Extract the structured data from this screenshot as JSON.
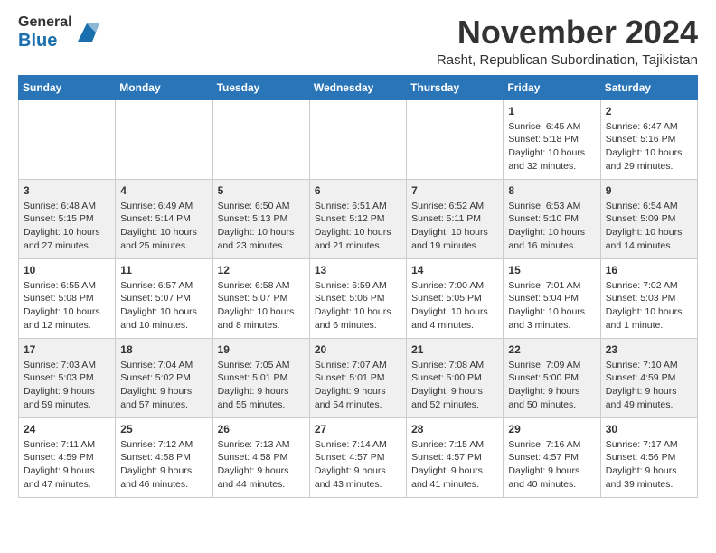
{
  "header": {
    "logo_general": "General",
    "logo_blue": "Blue",
    "month_title": "November 2024",
    "subtitle": "Rasht, Republican Subordination, Tajikistan"
  },
  "weekdays": [
    "Sunday",
    "Monday",
    "Tuesday",
    "Wednesday",
    "Thursday",
    "Friday",
    "Saturday"
  ],
  "weeks": [
    {
      "row_shade": "odd",
      "days": [
        {
          "num": "",
          "info": ""
        },
        {
          "num": "",
          "info": ""
        },
        {
          "num": "",
          "info": ""
        },
        {
          "num": "",
          "info": ""
        },
        {
          "num": "",
          "info": ""
        },
        {
          "num": "1",
          "info": "Sunrise: 6:45 AM\nSunset: 5:18 PM\nDaylight: 10 hours\nand 32 minutes."
        },
        {
          "num": "2",
          "info": "Sunrise: 6:47 AM\nSunset: 5:16 PM\nDaylight: 10 hours\nand 29 minutes."
        }
      ]
    },
    {
      "row_shade": "even",
      "days": [
        {
          "num": "3",
          "info": "Sunrise: 6:48 AM\nSunset: 5:15 PM\nDaylight: 10 hours\nand 27 minutes."
        },
        {
          "num": "4",
          "info": "Sunrise: 6:49 AM\nSunset: 5:14 PM\nDaylight: 10 hours\nand 25 minutes."
        },
        {
          "num": "5",
          "info": "Sunrise: 6:50 AM\nSunset: 5:13 PM\nDaylight: 10 hours\nand 23 minutes."
        },
        {
          "num": "6",
          "info": "Sunrise: 6:51 AM\nSunset: 5:12 PM\nDaylight: 10 hours\nand 21 minutes."
        },
        {
          "num": "7",
          "info": "Sunrise: 6:52 AM\nSunset: 5:11 PM\nDaylight: 10 hours\nand 19 minutes."
        },
        {
          "num": "8",
          "info": "Sunrise: 6:53 AM\nSunset: 5:10 PM\nDaylight: 10 hours\nand 16 minutes."
        },
        {
          "num": "9",
          "info": "Sunrise: 6:54 AM\nSunset: 5:09 PM\nDaylight: 10 hours\nand 14 minutes."
        }
      ]
    },
    {
      "row_shade": "odd",
      "days": [
        {
          "num": "10",
          "info": "Sunrise: 6:55 AM\nSunset: 5:08 PM\nDaylight: 10 hours\nand 12 minutes."
        },
        {
          "num": "11",
          "info": "Sunrise: 6:57 AM\nSunset: 5:07 PM\nDaylight: 10 hours\nand 10 minutes."
        },
        {
          "num": "12",
          "info": "Sunrise: 6:58 AM\nSunset: 5:07 PM\nDaylight: 10 hours\nand 8 minutes."
        },
        {
          "num": "13",
          "info": "Sunrise: 6:59 AM\nSunset: 5:06 PM\nDaylight: 10 hours\nand 6 minutes."
        },
        {
          "num": "14",
          "info": "Sunrise: 7:00 AM\nSunset: 5:05 PM\nDaylight: 10 hours\nand 4 minutes."
        },
        {
          "num": "15",
          "info": "Sunrise: 7:01 AM\nSunset: 5:04 PM\nDaylight: 10 hours\nand 3 minutes."
        },
        {
          "num": "16",
          "info": "Sunrise: 7:02 AM\nSunset: 5:03 PM\nDaylight: 10 hours\nand 1 minute."
        }
      ]
    },
    {
      "row_shade": "even",
      "days": [
        {
          "num": "17",
          "info": "Sunrise: 7:03 AM\nSunset: 5:03 PM\nDaylight: 9 hours\nand 59 minutes."
        },
        {
          "num": "18",
          "info": "Sunrise: 7:04 AM\nSunset: 5:02 PM\nDaylight: 9 hours\nand 57 minutes."
        },
        {
          "num": "19",
          "info": "Sunrise: 7:05 AM\nSunset: 5:01 PM\nDaylight: 9 hours\nand 55 minutes."
        },
        {
          "num": "20",
          "info": "Sunrise: 7:07 AM\nSunset: 5:01 PM\nDaylight: 9 hours\nand 54 minutes."
        },
        {
          "num": "21",
          "info": "Sunrise: 7:08 AM\nSunset: 5:00 PM\nDaylight: 9 hours\nand 52 minutes."
        },
        {
          "num": "22",
          "info": "Sunrise: 7:09 AM\nSunset: 5:00 PM\nDaylight: 9 hours\nand 50 minutes."
        },
        {
          "num": "23",
          "info": "Sunrise: 7:10 AM\nSunset: 4:59 PM\nDaylight: 9 hours\nand 49 minutes."
        }
      ]
    },
    {
      "row_shade": "odd",
      "days": [
        {
          "num": "24",
          "info": "Sunrise: 7:11 AM\nSunset: 4:59 PM\nDaylight: 9 hours\nand 47 minutes."
        },
        {
          "num": "25",
          "info": "Sunrise: 7:12 AM\nSunset: 4:58 PM\nDaylight: 9 hours\nand 46 minutes."
        },
        {
          "num": "26",
          "info": "Sunrise: 7:13 AM\nSunset: 4:58 PM\nDaylight: 9 hours\nand 44 minutes."
        },
        {
          "num": "27",
          "info": "Sunrise: 7:14 AM\nSunset: 4:57 PM\nDaylight: 9 hours\nand 43 minutes."
        },
        {
          "num": "28",
          "info": "Sunrise: 7:15 AM\nSunset: 4:57 PM\nDaylight: 9 hours\nand 41 minutes."
        },
        {
          "num": "29",
          "info": "Sunrise: 7:16 AM\nSunset: 4:57 PM\nDaylight: 9 hours\nand 40 minutes."
        },
        {
          "num": "30",
          "info": "Sunrise: 7:17 AM\nSunset: 4:56 PM\nDaylight: 9 hours\nand 39 minutes."
        }
      ]
    }
  ]
}
